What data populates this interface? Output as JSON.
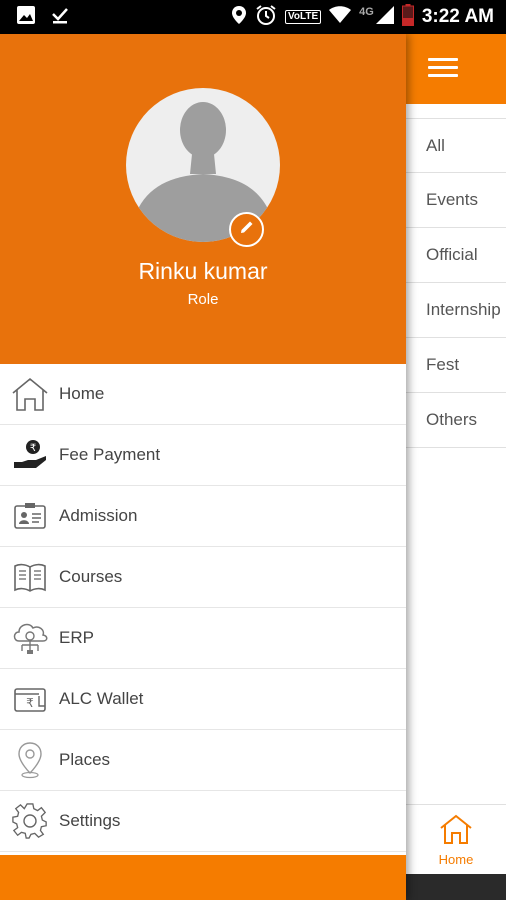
{
  "status_bar": {
    "time": "3:22 AM",
    "volte": "VoLTE",
    "network": "4G"
  },
  "drawer": {
    "user_name": "Rinku kumar",
    "user_role": "Role",
    "menu": [
      {
        "label": "Home",
        "icon": "home-icon"
      },
      {
        "label": "Fee Payment",
        "icon": "fee-payment-icon"
      },
      {
        "label": "Admission",
        "icon": "admission-icon"
      },
      {
        "label": "Courses",
        "icon": "courses-icon"
      },
      {
        "label": "ERP",
        "icon": "erp-icon"
      },
      {
        "label": "ALC Wallet",
        "icon": "wallet-icon"
      },
      {
        "label": "Places",
        "icon": "places-icon"
      },
      {
        "label": "Settings",
        "icon": "settings-icon"
      }
    ]
  },
  "background": {
    "categories": [
      "All",
      "Events",
      "Official",
      "Internship",
      "Fest",
      "Others"
    ],
    "bottom_nav_label": "Home"
  },
  "colors": {
    "accent": "#f57c00",
    "header": "#e8720c"
  }
}
